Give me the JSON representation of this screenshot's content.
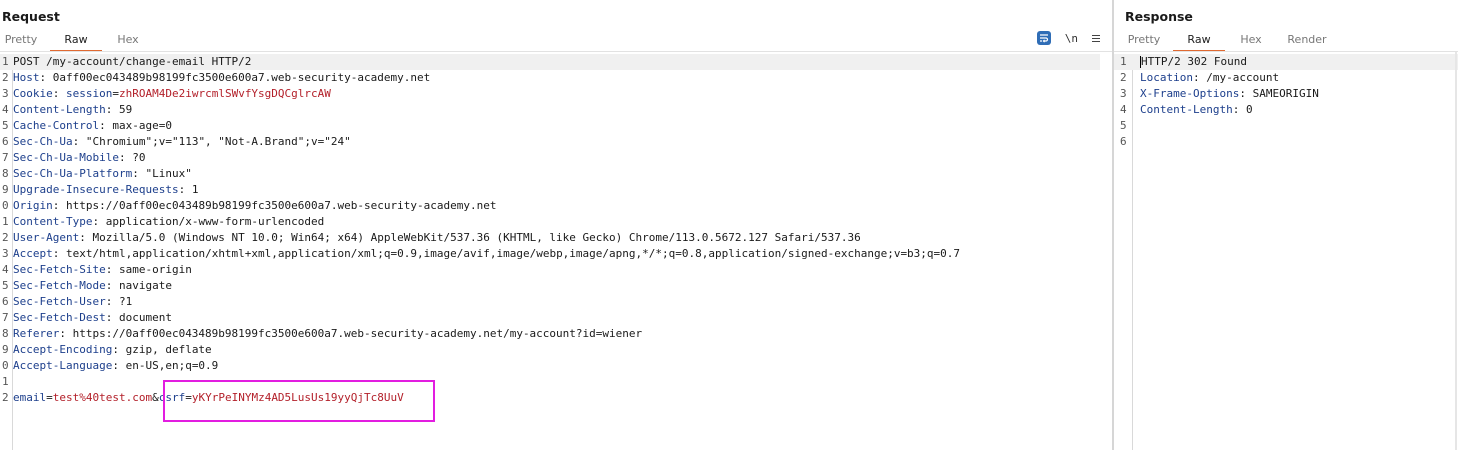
{
  "request": {
    "title": "Request",
    "tabs": [
      "Pretty",
      "Raw",
      "Hex"
    ],
    "active_tab": "Raw",
    "tools": {
      "newline_label": "\\n"
    },
    "lines": [
      {
        "n": "1",
        "parts": [
          {
            "t": "POST /my-account/change-email HTTP/2",
            "c": "v"
          }
        ]
      },
      {
        "n": "2",
        "parts": [
          {
            "t": "Host",
            "c": "k"
          },
          {
            "t": ": 0aff00ec043489b98199fc3500e600a7.web-security-academy.net",
            "c": "v"
          }
        ]
      },
      {
        "n": "3",
        "parts": [
          {
            "t": "Cookie",
            "c": "k"
          },
          {
            "t": ": ",
            "c": "v"
          },
          {
            "t": "session",
            "c": "pk"
          },
          {
            "t": "=",
            "c": "v"
          },
          {
            "t": "zhROAM4De2iwrcmlSWvfYsgDQCglrcAW",
            "c": "pv"
          }
        ]
      },
      {
        "n": "4",
        "parts": [
          {
            "t": "Content-Length",
            "c": "k"
          },
          {
            "t": ": 59",
            "c": "v"
          }
        ]
      },
      {
        "n": "5",
        "parts": [
          {
            "t": "Cache-Control",
            "c": "k"
          },
          {
            "t": ": max-age=0",
            "c": "v"
          }
        ]
      },
      {
        "n": "6",
        "parts": [
          {
            "t": "Sec-Ch-Ua",
            "c": "k"
          },
          {
            "t": ": \"Chromium\";v=\"113\", \"Not-A.Brand\";v=\"24\"",
            "c": "v"
          }
        ]
      },
      {
        "n": "7",
        "parts": [
          {
            "t": "Sec-Ch-Ua-Mobile",
            "c": "k"
          },
          {
            "t": ": ?0",
            "c": "v"
          }
        ]
      },
      {
        "n": "8",
        "parts": [
          {
            "t": "Sec-Ch-Ua-Platform",
            "c": "k"
          },
          {
            "t": ": \"Linux\"",
            "c": "v"
          }
        ]
      },
      {
        "n": "9",
        "parts": [
          {
            "t": "Upgrade-Insecure-Requests",
            "c": "k"
          },
          {
            "t": ": 1",
            "c": "v"
          }
        ]
      },
      {
        "n": "0",
        "parts": [
          {
            "t": "Origin",
            "c": "k"
          },
          {
            "t": ": https://0aff00ec043489b98199fc3500e600a7.web-security-academy.net",
            "c": "v"
          }
        ]
      },
      {
        "n": "1",
        "parts": [
          {
            "t": "Content-Type",
            "c": "k"
          },
          {
            "t": ": application/x-www-form-urlencoded",
            "c": "v"
          }
        ]
      },
      {
        "n": "2",
        "parts": [
          {
            "t": "User-Agent",
            "c": "k"
          },
          {
            "t": ": Mozilla/5.0 (Windows NT 10.0; Win64; x64) AppleWebKit/537.36 (KHTML, like Gecko) Chrome/113.0.5672.127 Safari/537.36",
            "c": "v"
          }
        ]
      },
      {
        "n": "3",
        "parts": [
          {
            "t": "Accept",
            "c": "k"
          },
          {
            "t": ": text/html,application/xhtml+xml,application/xml;q=0.9,image/avif,image/webp,image/apng,*/*;q=0.8,application/signed-exchange;v=b3;q=0.7",
            "c": "v"
          }
        ]
      },
      {
        "n": "4",
        "parts": [
          {
            "t": "Sec-Fetch-Site",
            "c": "k"
          },
          {
            "t": ": same-origin",
            "c": "v"
          }
        ]
      },
      {
        "n": "5",
        "parts": [
          {
            "t": "Sec-Fetch-Mode",
            "c": "k"
          },
          {
            "t": ": navigate",
            "c": "v"
          }
        ]
      },
      {
        "n": "6",
        "parts": [
          {
            "t": "Sec-Fetch-User",
            "c": "k"
          },
          {
            "t": ": ?1",
            "c": "v"
          }
        ]
      },
      {
        "n": "7",
        "parts": [
          {
            "t": "Sec-Fetch-Dest",
            "c": "k"
          },
          {
            "t": ": document",
            "c": "v"
          }
        ]
      },
      {
        "n": "8",
        "parts": [
          {
            "t": "Referer",
            "c": "k"
          },
          {
            "t": ": https://0aff00ec043489b98199fc3500e600a7.web-security-academy.net/my-account?id=wiener",
            "c": "v"
          }
        ]
      },
      {
        "n": "9",
        "parts": [
          {
            "t": "Accept-Encoding",
            "c": "k"
          },
          {
            "t": ": gzip, deflate",
            "c": "v"
          }
        ]
      },
      {
        "n": "0",
        "parts": [
          {
            "t": "Accept-Language",
            "c": "k"
          },
          {
            "t": ": en-US,en;q=0.9",
            "c": "v"
          }
        ]
      },
      {
        "n": "1",
        "parts": []
      },
      {
        "n": "2",
        "parts": [
          {
            "t": "email",
            "c": "pk"
          },
          {
            "t": "=",
            "c": "v"
          },
          {
            "t": "test%40test.com",
            "c": "pv"
          },
          {
            "t": "&",
            "c": "v"
          },
          {
            "t": "csrf",
            "c": "pk"
          },
          {
            "t": "=",
            "c": "v"
          },
          {
            "t": "yKYrPeINYMz4AD5LusUs19yyQjTc8UuV",
            "c": "pv"
          }
        ]
      }
    ]
  },
  "response": {
    "title": "Response",
    "tabs": [
      "Pretty",
      "Raw",
      "Hex",
      "Render"
    ],
    "active_tab": "Raw",
    "lines": [
      {
        "n": "1",
        "parts": [
          {
            "t": "HTTP/2 302 Found",
            "c": "v"
          }
        ]
      },
      {
        "n": "2",
        "parts": [
          {
            "t": "Location",
            "c": "k"
          },
          {
            "t": ": /my-account",
            "c": "v"
          }
        ]
      },
      {
        "n": "3",
        "parts": [
          {
            "t": "X-Frame-Options",
            "c": "k"
          },
          {
            "t": ": SAMEORIGIN",
            "c": "v"
          }
        ]
      },
      {
        "n": "4",
        "parts": [
          {
            "t": "Content-Length",
            "c": "k"
          },
          {
            "t": ": 0",
            "c": "v"
          }
        ]
      },
      {
        "n": "5",
        "parts": []
      },
      {
        "n": "6",
        "parts": []
      }
    ]
  },
  "colors": {
    "accent_tab": "#e06a32",
    "header_key": "#1d3f8c",
    "param_value": "#b3202a",
    "highlight_box": "#e21de0"
  }
}
